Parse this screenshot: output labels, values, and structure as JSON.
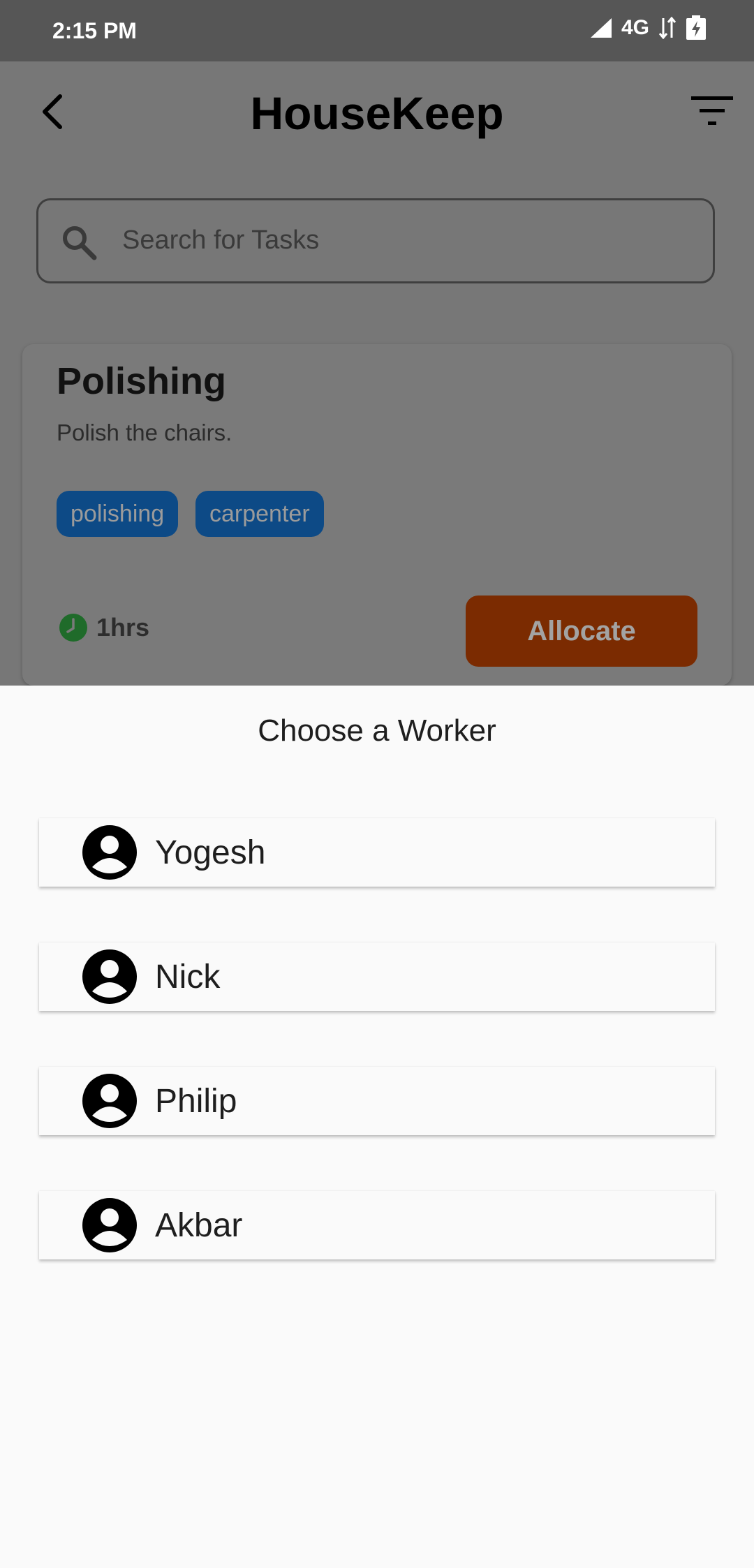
{
  "status_bar": {
    "time": "2:15 PM",
    "network": "4G"
  },
  "app_bar": {
    "title": "HouseKeep",
    "back_icon": "back-chevron-icon",
    "filter_icon": "filter-icon"
  },
  "search": {
    "placeholder": "Search for Tasks"
  },
  "task": {
    "title": "Polishing",
    "description": "Polish the chairs.",
    "tags": [
      "polishing",
      "carpenter"
    ],
    "duration": "1hrs",
    "allocate_label": "Allocate"
  },
  "sheet": {
    "title": "Choose a Worker",
    "workers": [
      {
        "name": "Yogesh"
      },
      {
        "name": "Nick"
      },
      {
        "name": "Philip"
      },
      {
        "name": "Akbar"
      }
    ]
  },
  "colors": {
    "tag_bg": "#0d4a86",
    "allocate_bg": "#7b2b01",
    "clock_green": "#1f6b2a",
    "scrim": "#777777"
  }
}
